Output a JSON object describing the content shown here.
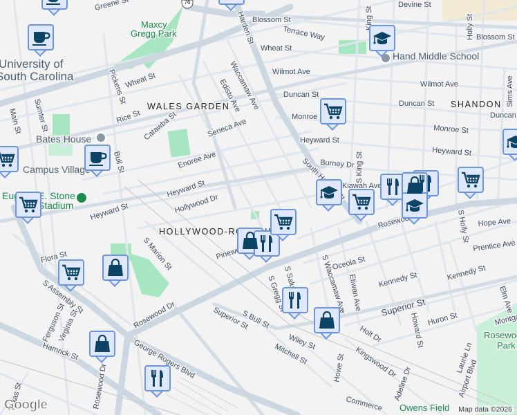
{
  "map": {
    "neighborhoods": [
      "WALES GARDEN",
      "HOLLYWOOD-ROSE HILL",
      "SHANDON"
    ],
    "pois": [
      "University of",
      "South Carolina",
      "Bates House",
      "Campus Village",
      "Eugene E. Stone",
      "Stadium",
      "Hand Middle School"
    ],
    "parks": [
      "Maxcy",
      "Gregg Park",
      "Rosewood",
      "Park",
      "Owens Field"
    ],
    "route_shield": "76",
    "streets": [
      "Greene St",
      "Devine St",
      "Blossom St",
      "Terrace Way",
      "Wheat St",
      "Blossom St",
      "Holly St",
      "King St",
      "Wilmot Ave",
      "Wilmot Ave",
      "Duncan St",
      "Duncan St",
      "Duncan",
      "Sims Ave",
      "Monroe",
      "Monroe St",
      "Heyward St",
      "Heyward St",
      "Burney Dr",
      "S King St",
      "Kiawah Ave",
      "South Harden St",
      "Harden St",
      "Wheat St",
      "Pickens St",
      "Rice St",
      "Waccamaw Ave",
      "Edisto Ave",
      "Seneca Ave",
      "Catawba St",
      "Enoree Ave",
      "Heyward St",
      "Hollywood Dr",
      "Heyward St",
      "Bull St",
      "Sumter St",
      "Main St",
      "Flora St",
      "S Marion St",
      "Pinewood",
      "S Assembly St",
      "Rosewood Dr",
      "Rosewood Dr",
      "Ferguson St",
      "Virginia St",
      "Hamrick St",
      "George Rogers Blvd",
      "Superior St",
      "S Bull St",
      "S Gregg St",
      "S Saluda Ave",
      "Oceola St",
      "S Waccamaw Ave",
      "Etiwan Ave",
      "Kennedy St",
      "Kennedy St",
      "Superior St",
      "Hope Ave",
      "Prentice Ave",
      "S Holly St",
      "Elm Ave",
      "Montgomery",
      "Huron St",
      "Howard St",
      "Holt Dr",
      "Wiley St",
      "Mitchell St",
      "Kingswood Dr",
      "Howe St",
      "Adeline Dr",
      "Laurie Ln",
      "Airport Blvd",
      "Commerce",
      "Texas St",
      "Rosewood Dr"
    ],
    "attribution": "Map data ©2026",
    "logo": "Google"
  },
  "colors": {
    "marker_fill": "#dfe9fb",
    "marker_border": "#6d95dc",
    "icon": "#0d4466",
    "park": "#a8e6c1",
    "road": "#d3dce5",
    "background": "#f4f3f4"
  },
  "markers": [
    {
      "type": "coffee-icon"
    },
    {
      "type": "coffee-icon"
    },
    {
      "type": "shopping-cart-icon"
    },
    {
      "type": "coffee-icon"
    },
    {
      "type": "shopping-cart-icon"
    },
    {
      "type": "shopping-cart-icon"
    },
    {
      "type": "shopping-bag-icon"
    },
    {
      "type": "shopping-bag-icon"
    },
    {
      "type": "restaurant-icon"
    },
    {
      "type": "shopping-bag-icon"
    },
    {
      "type": "school-icon"
    },
    {
      "type": "shopping-cart-icon"
    },
    {
      "type": "school-icon"
    },
    {
      "type": "school-icon"
    },
    {
      "type": "shopping-cart-icon"
    },
    {
      "type": "restaurant-icon"
    },
    {
      "type": "restaurant-icon"
    },
    {
      "type": "shopping-bag-icon"
    },
    {
      "type": "school-icon"
    },
    {
      "type": "shopping-cart-icon"
    },
    {
      "type": "shopping-bag-icon"
    },
    {
      "type": "restaurant-icon"
    },
    {
      "type": "shopping-cart-icon"
    },
    {
      "type": "restaurant-icon"
    },
    {
      "type": "shopping-bag-icon"
    }
  ]
}
